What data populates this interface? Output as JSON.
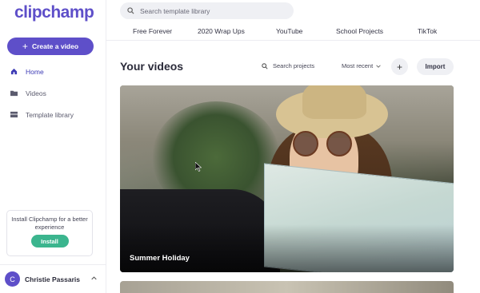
{
  "app": {
    "logo": "clipchamp"
  },
  "sidebar": {
    "create_label": "Create a video",
    "items": [
      {
        "label": "Home",
        "icon": "home-icon",
        "active": true
      },
      {
        "label": "Videos",
        "icon": "folder-icon",
        "active": false
      },
      {
        "label": "Template library",
        "icon": "template-icon",
        "active": false
      }
    ],
    "install_card": {
      "text": "Install Clipchamp for a better experience",
      "button": "Install"
    },
    "user": {
      "initial": "C",
      "name": "Christie Passaris"
    }
  },
  "header": {
    "search_placeholder": "Search template library",
    "categories": [
      "Free Forever",
      "2020 Wrap Ups",
      "YouTube",
      "School Projects",
      "TikTok"
    ]
  },
  "main": {
    "title": "Your videos",
    "search_projects": "Search projects",
    "sort_label": "Most recent",
    "add_symbol": "+",
    "import_label": "Import",
    "videos": [
      {
        "title": "Summer Holiday"
      }
    ]
  },
  "colors": {
    "brand": "#5e4fc9",
    "install": "#3bb58e"
  }
}
